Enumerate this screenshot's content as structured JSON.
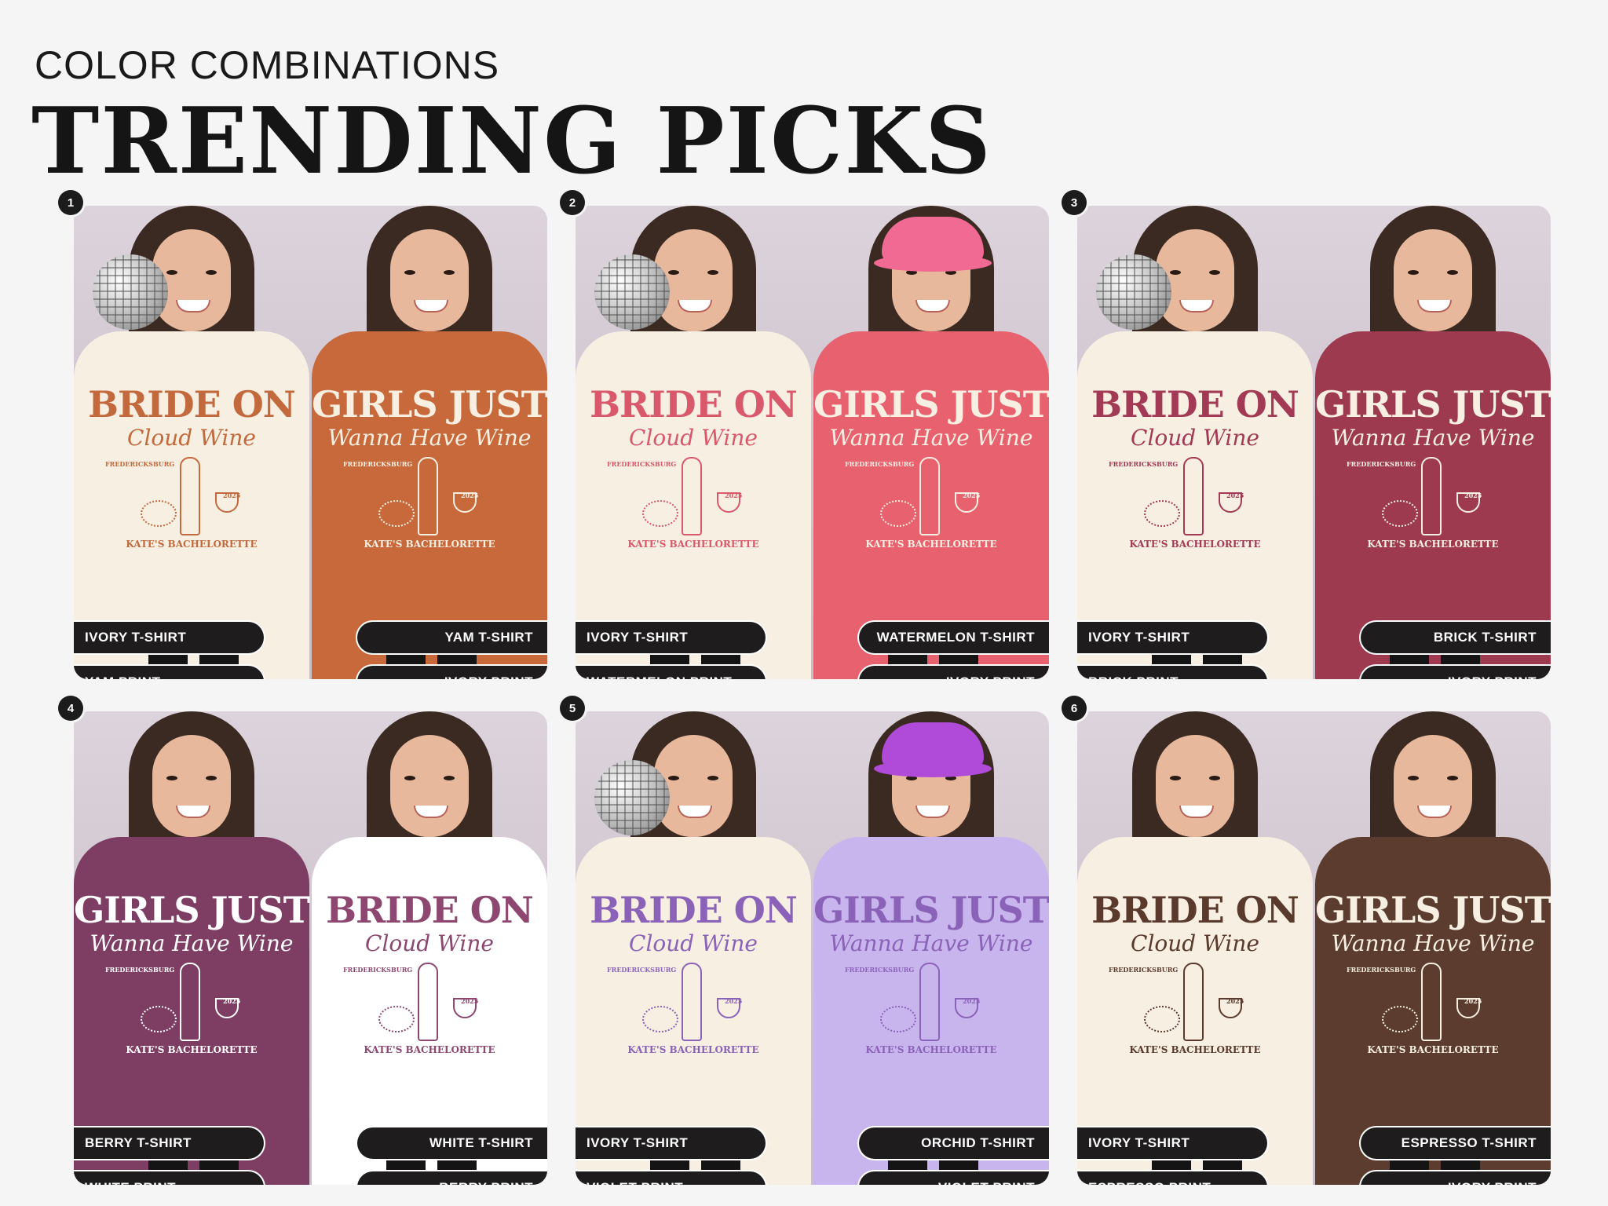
{
  "header": {
    "subtitle": "COLOR COMBINATIONS",
    "title": "TRENDING PICKS"
  },
  "shirt_text": {
    "bride_main": "BRIDE ON",
    "bride_script": "Cloud Wine",
    "girls_main": "GIRLS JUST",
    "girls_script": "Wanna Have Wine",
    "location": "FREDERICKSBURG",
    "year": "2025",
    "bottom": "KATE'S BACHELORETTE"
  },
  "cards": [
    {
      "number": "1",
      "left_shirt": "IVORY T-SHIRT",
      "left_print": "YAM PRINT",
      "right_shirt": "YAM T-SHIRT",
      "right_print": "IVORY PRINT",
      "left_design": "bride",
      "right_design": "girls",
      "left_shirt_color": "#f6efe2",
      "left_print_color": "#c26a3d",
      "right_shirt_color": "#c8693b",
      "right_print_color": "#f6efe2",
      "props": [
        "disco-ball-left"
      ]
    },
    {
      "number": "2",
      "left_shirt": "IVORY T-SHIRT",
      "left_print": "WATERMELON PRINT",
      "right_shirt": "WATERMELON T-SHIRT",
      "right_print": "IVORY PRINT",
      "left_design": "bride",
      "right_design": "girls",
      "left_shirt_color": "#f6efe2",
      "left_print_color": "#d9586b",
      "right_shirt_color": "#e8616f",
      "right_print_color": "#f6efe2",
      "props": [
        "disco-ball-left",
        "pink-cowboy-hat-right"
      ],
      "hat_color": "#f06a93"
    },
    {
      "number": "3",
      "left_shirt": "IVORY T-SHIRT",
      "left_print": "BRICK PRINT",
      "right_shirt": "BRICK T-SHIRT",
      "right_print": "IVORY PRINT",
      "left_design": "bride",
      "right_design": "girls",
      "left_shirt_color": "#f6efe2",
      "left_print_color": "#a33a55",
      "right_shirt_color": "#9d3a4f",
      "right_print_color": "#f6efe2",
      "props": [
        "disco-ball-left"
      ]
    },
    {
      "number": "4",
      "left_shirt": "BERRY T-SHIRT",
      "left_print": "WHITE PRINT",
      "right_shirt": "WHITE T-SHIRT",
      "right_print": "BERRY PRINT",
      "left_design": "girls",
      "right_design": "bride",
      "left_shirt_color": "#7e3e63",
      "left_print_color": "#ffffff",
      "right_shirt_color": "#ffffff",
      "right_print_color": "#8d4770",
      "props": []
    },
    {
      "number": "5",
      "left_shirt": "IVORY T-SHIRT",
      "left_print": "VIOLET PRINT",
      "right_shirt": "ORCHID T-SHIRT",
      "right_print": "VIOLET PRINT",
      "left_design": "bride",
      "right_design": "girls",
      "left_shirt_color": "#f6efe2",
      "left_print_color": "#8a62b8",
      "right_shirt_color": "#c9b5ee",
      "right_print_color": "#8a62b8",
      "props": [
        "disco-ball-left",
        "purple-cowboy-hat-right"
      ],
      "hat_color": "#b04ad8"
    },
    {
      "number": "6",
      "left_shirt": "IVORY T-SHIRT",
      "left_print": "ESPRESSO PRINT",
      "right_shirt": "ESPRESSO T-SHIRT",
      "right_print": "IVORY PRINT",
      "left_design": "bride",
      "right_design": "girls",
      "left_shirt_color": "#f6efe2",
      "left_print_color": "#5a3a2c",
      "right_shirt_color": "#5b3c2e",
      "right_print_color": "#f6efe2",
      "props": []
    }
  ]
}
